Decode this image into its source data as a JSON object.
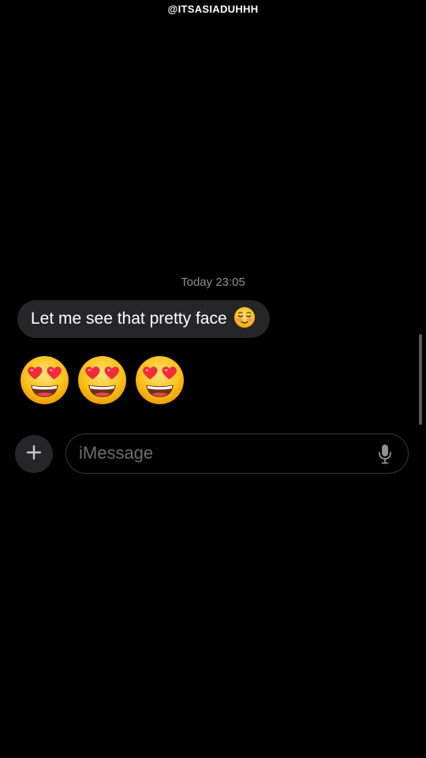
{
  "watermark": "@ITSASIADUHHH",
  "conversation": {
    "timestamp": "Today 23:05",
    "received_message": {
      "text": "Let me see that pretty face",
      "trailing_emoji_icon": "smiling-face-with-blush-icon"
    },
    "emoji_message": {
      "emoji_icon": "smiling-face-with-heart-eyes-icon",
      "count": 3
    }
  },
  "compose_bar": {
    "add_button_icon": "plus-icon",
    "placeholder": "iMessage",
    "value": "",
    "mic_icon": "microphone-icon"
  },
  "colors": {
    "background": "#000000",
    "bubble": "#262629",
    "timestamp_text": "#8e8e93",
    "placeholder_text": "#6d6d72",
    "input_border": "#3a3a3c"
  }
}
